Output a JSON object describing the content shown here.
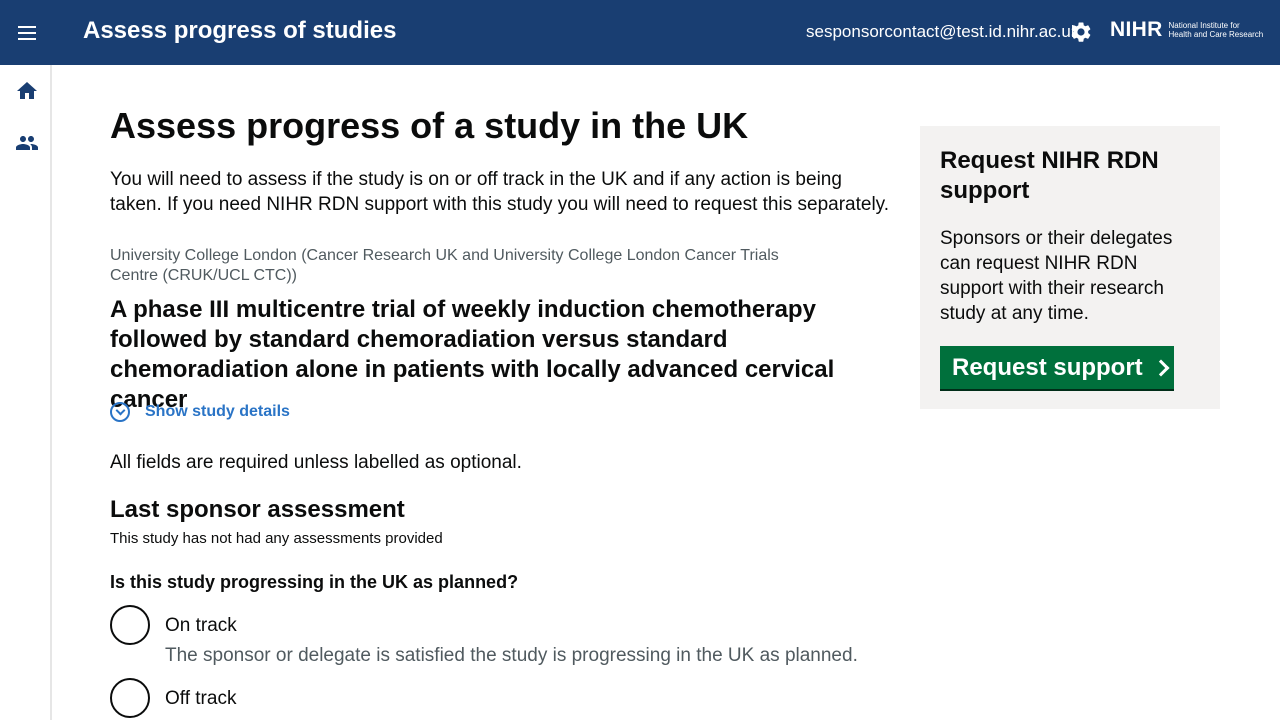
{
  "header": {
    "title": "Assess progress of studies",
    "user_email": "sesponsorcontact@test.id.nihr.ac.uk",
    "logo_text": "NIHR",
    "logo_subtext_line1": "National Institute for",
    "logo_subtext_line2": "Health and Care Research"
  },
  "sidebar": {
    "items": [
      {
        "icon": "home-icon"
      },
      {
        "icon": "people-icon"
      }
    ]
  },
  "main": {
    "page_title": "Assess progress of a study in the UK",
    "intro": "You will need to assess if the study is on or off track in the UK and if any action is being taken. If you need NIHR RDN support with this study you will need to request this separately.",
    "organisation": "University College London (Cancer Research UK and University College London Cancer Trials Centre (CRUK/UCL CTC))",
    "study_title": "A phase III multicentre trial of weekly induction chemotherapy followed by standard chemoradiation versus standard chemoradiation alone in patients with locally advanced cervical cancer",
    "details_toggle": "Show study details",
    "required_note": "All fields are required unless labelled as optional.",
    "last_assessment_heading": "Last sponsor assessment",
    "last_assessment_text": "This study has not had any assessments provided",
    "question": "Is this study progressing in the UK as planned?",
    "options": [
      {
        "label": "On track",
        "hint": "The sponsor or delegate is satisfied the study is progressing in the UK as planned."
      },
      {
        "label": "Off track",
        "hint": ""
      }
    ]
  },
  "aside": {
    "title": "Request NIHR RDN support",
    "text": "Sponsors or their delegates can request NIHR RDN support with their research study at any time.",
    "button_label": "Request support"
  },
  "colors": {
    "header_bg": "#193e72",
    "button_green": "#00703c",
    "link_blue": "#2a74c6",
    "aside_bg": "#f3f2f1"
  }
}
